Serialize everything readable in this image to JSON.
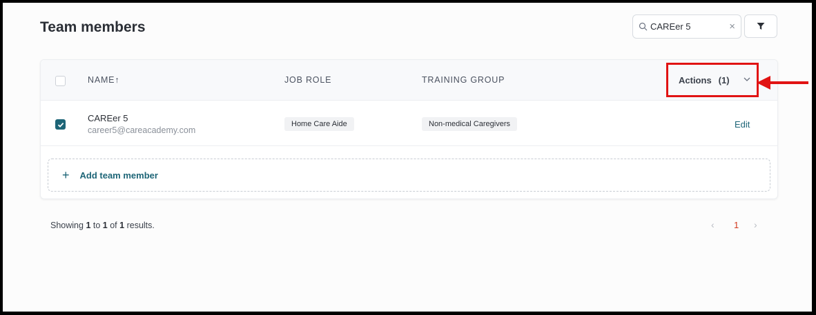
{
  "page": {
    "title": "Team members"
  },
  "search": {
    "value": "CAREer 5",
    "clear_glyph": "×",
    "icon": "search-icon"
  },
  "filter": {
    "icon": "filter-icon"
  },
  "table": {
    "columns": {
      "name": "NAME↑",
      "job_role": "JOB ROLE",
      "training_group": "TRAINING GROUP"
    },
    "actions": {
      "label": "Actions",
      "count": "(1)"
    },
    "rows": [
      {
        "selected": true,
        "name": "CAREer 5",
        "email": "career5@careacademy.com",
        "job_role": "Home Care Aide",
        "training_group": "Non-medical Caregivers",
        "edit_label": "Edit"
      }
    ],
    "add_member": {
      "plus": "+",
      "label": "Add team member"
    }
  },
  "pagination": {
    "prefix": "Showing",
    "from": "1",
    "to_word": "to",
    "to": "1",
    "of_word": "of",
    "total": "1",
    "suffix": "results.",
    "prev_glyph": "‹",
    "current_page": "1",
    "next_glyph": "›"
  },
  "colors": {
    "accent": "#1d6577",
    "highlight": "#e11313",
    "current_page": "#d23a1f"
  }
}
